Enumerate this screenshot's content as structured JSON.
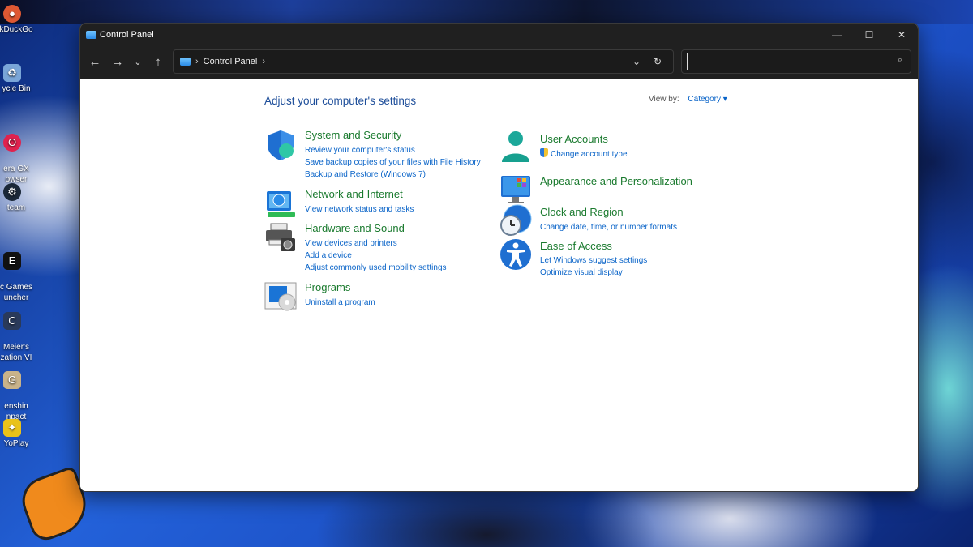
{
  "desktop": {
    "icons": [
      {
        "label": "kDuckGo",
        "icon": "duckduckgo-icon",
        "color": "#de5833"
      },
      {
        "label": "ycle Bin",
        "icon": "recycle-bin-icon",
        "color": "#7aa6d8"
      },
      {
        "label": "era GX\nowser",
        "icon": "opera-gx-icon",
        "color": "#e0224e"
      },
      {
        "label": "team",
        "icon": "steam-icon",
        "color": "#1b2838"
      },
      {
        "label": "c Games\nuncher",
        "icon": "epic-games-icon",
        "color": "#111111"
      },
      {
        "label": "Meier's\nzation VI",
        "icon": "civilization-icon",
        "color": "#2a3a5a"
      },
      {
        "label": "enshin\nnpact",
        "icon": "genshin-icon",
        "color": "#c9b38a"
      },
      {
        "label": "YoPlay",
        "icon": "hoyoplay-icon",
        "color": "#e9c21a"
      }
    ]
  },
  "window": {
    "title": "Control Panel",
    "controls": {
      "minimize": "—",
      "maximize": "☐",
      "close": "✕"
    },
    "nav": {
      "back": "←",
      "forward": "→",
      "recent": "⌄",
      "up": "↑"
    },
    "address": {
      "crumb": "Control Panel",
      "sep1": "›",
      "sep2": "›",
      "dropdown": "⌄",
      "refresh": "↻"
    },
    "search": {
      "value": "",
      "placeholder": "",
      "icon": "⌕"
    }
  },
  "content": {
    "heading": "Adjust your computer's settings",
    "view_by_label": "View by:",
    "view_by_value": "Category ▾",
    "left_categories": [
      {
        "title": "System and Security",
        "icon": "shield-icon",
        "links": [
          "Review your computer's status",
          "Save backup copies of your files with File History",
          "Backup and Restore (Windows 7)"
        ]
      },
      {
        "title": "Network and Internet",
        "icon": "network-icon",
        "links": [
          "View network status and tasks"
        ]
      },
      {
        "title": "Hardware and Sound",
        "icon": "printer-icon",
        "links": [
          "View devices and printers",
          "Add a device",
          "Adjust commonly used mobility settings"
        ]
      },
      {
        "title": "Programs",
        "icon": "programs-icon",
        "links": [
          "Uninstall a program"
        ]
      }
    ],
    "right_categories": [
      {
        "title": "User Accounts",
        "icon": "user-icon",
        "links": [
          "Change account type"
        ]
      },
      {
        "title": "Appearance and Personalization",
        "icon": "monitor-icon",
        "links": []
      },
      {
        "title": "Clock and Region",
        "icon": "clock-globe-icon",
        "links": [
          "Change date, time, or number formats"
        ]
      },
      {
        "title": "Ease of Access",
        "icon": "accessibility-icon",
        "links": [
          "Let Windows suggest settings",
          "Optimize visual display"
        ]
      }
    ]
  }
}
